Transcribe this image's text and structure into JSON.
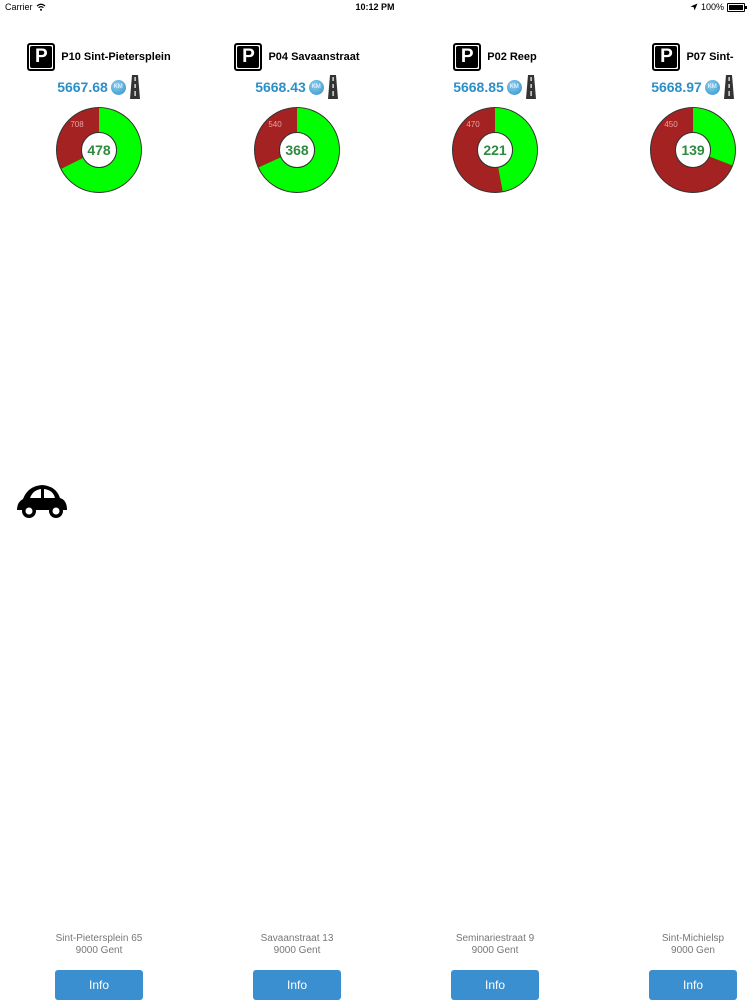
{
  "status_bar": {
    "carrier": "Carrier",
    "time": "10:12 PM",
    "battery": "100%"
  },
  "km_badge": "KM",
  "parkings": [
    {
      "name": "P10 Sint-Pietersplein",
      "distance": "5667.68",
      "total": "708",
      "free": "478",
      "free_fraction": 0.675,
      "address_line1": "Sint-Pietersplein 65",
      "address_line2": "9000 Gent",
      "button": "Info"
    },
    {
      "name": "P04 Savaanstraat",
      "distance": "5668.43",
      "total": "540",
      "free": "368",
      "free_fraction": 0.681,
      "address_line1": "Savaanstraat 13",
      "address_line2": "9000 Gent",
      "button": "Info"
    },
    {
      "name": "P02 Reep",
      "distance": "5668.85",
      "total": "470",
      "free": "221",
      "free_fraction": 0.47,
      "address_line1": "Seminariestraat 9",
      "address_line2": "9000 Gent",
      "button": "Info"
    },
    {
      "name": "P07 Sint-",
      "distance": "5668.97",
      "total": "450",
      "free": "139",
      "free_fraction": 0.309,
      "address_line1": "Sint-Michielsp",
      "address_line2": "9000 Gen",
      "button": "Info"
    }
  ],
  "colors": {
    "free": "#00ff00",
    "occupied": "#a52222",
    "distance": "#2d8fc7",
    "button": "#3a8fd0"
  }
}
